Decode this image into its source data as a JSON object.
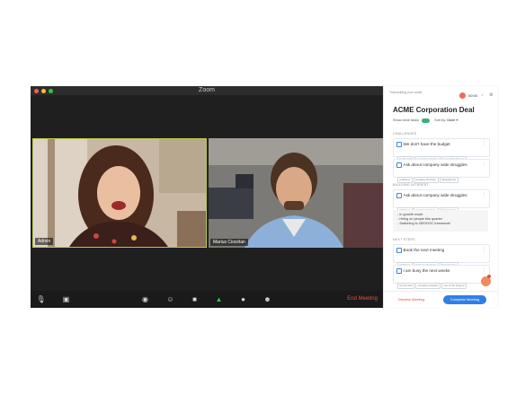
{
  "zoom": {
    "title": "Zoom",
    "participants": [
      {
        "name": "Admin"
      },
      {
        "name": "Marius Ciocirlan"
      }
    ],
    "toolbar": {
      "end_label": "End Meeting"
    },
    "dot_colors": [
      "#f25f57",
      "#fbbc2e",
      "#2ac940"
    ]
  },
  "panel": {
    "transcribing": "Transcribing your audio",
    "timer": "00:00",
    "deal_title": "ACME Corporation Deal",
    "show_done_label": "Show done tasks",
    "sort_label": "Sort by:",
    "sort_value": "Done",
    "sections": {
      "challenges": "CHALLENGES",
      "building_interest": "BUILDING INTEREST",
      "next_steps": "NEXT STEPS"
    },
    "cards": {
      "c1": {
        "title": "We don't have the budget",
        "tags": [
          "be the truth",
          "company structure",
          "use of the hang on"
        ]
      },
      "c2": {
        "title": "Ask about company wide struggles",
        "tags": [
          "problems",
          "company structure",
          "transparency"
        ]
      },
      "c3": {
        "title": "Ask about company wide struggles",
        "tags": [
          "problems",
          "company structure",
          "transparency"
        ]
      },
      "c4": {
        "title": "Book the next meeting",
        "tags": [
          "problems",
          "company structure",
          "transparency"
        ]
      },
      "c5": {
        "title": "I am busy the next weeks",
        "tags": [
          "be the truth",
          "company structure",
          "use of the hang on"
        ]
      }
    },
    "notes": [
      "- In growth mode",
      "- Hiring on people this quarter",
      "- Switching to NEDDOC framework"
    ],
    "dismiss_label": "Dismiss Meeting",
    "complete_label": "Complete Meeting",
    "accent_color": "#2f7fe8"
  }
}
